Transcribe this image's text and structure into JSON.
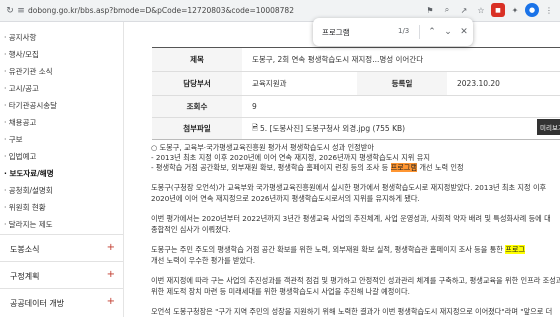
{
  "browser": {
    "url": "dobong.go.kr/bbs.asp?bmode=D&pCode=12720803&code=10008782",
    "find": {
      "query": "프로그램",
      "count": "1/3"
    }
  },
  "sidebar": {
    "sub_items": [
      "공지사항",
      "행사/모집",
      "유관기관 소식",
      "고시/공고",
      "타기관공시송달",
      "채용공고",
      "구보",
      "입법예고",
      "보도자료/해명",
      "공청회/설명회",
      "위원회 현황",
      "달라지는 제도"
    ],
    "active_sub": "보도자료/해명",
    "main_items": [
      "도봉소식",
      "구정계획",
      "공공데이터 개방"
    ]
  },
  "article": {
    "title_label": "제목",
    "title": "도봉구, 2회 연속 평생학습도시 재지정...명성 이어간다",
    "dept_label": "담당부서",
    "dept": "교육지원과",
    "date_label": "등록일",
    "date": "2023.10.20",
    "views_label": "조회수",
    "views": "9",
    "attach_label": "첨부파일",
    "attachment": "5. [도봉사진] 도봉구청사 외경.jpg (755 KB)",
    "preview_btn": "미리보기",
    "body": {
      "lead_1": "○ 도봉구, 교육부·국가평생교육진흥원 평가서 평생학습도시 성과 인정받아",
      "lead_2": "- 2013년 최초 지정 이후 2020년에 이어 연속 재지정, 2026년까지 평생학습도시 지위 유지",
      "lead_3a": "- 평생학습 거점 공간확보, 외부재원 확보, 평생학습 홈페이지 런칭 등의 조사 등 ",
      "lead_3b": "프로그램",
      "lead_3c": " 개선 노력 인정",
      "p1_1": "도봉구(구청장 오언석)가 교육부와 국가평생교육진흥원에서 실시한 평가에서 평생학습도시로 재지정받았다. 2013년 최초 지정 이후",
      "p1_2": "2020년에 이어 연속 재지정으로 2026년까지 평생학습도시로서의 지위를 유지하게 됐다.",
      "p2_1": "이번 평가에서는 2020년부터 2022년까지 3년간 평생교육 사업의 추진체계, 사업 운영성과, 사회적 약자 배려 및 특성화사례 등에 대",
      "p2_2": "종합적인 심사가 이뤄졌다.",
      "p3_1a": "도봉구는 주민 주도의 평생학습 거점 공간 확보를 위한 노력, 외부재원 확보 실적, 평생학습관 홈페이지 조사 등을 통한 ",
      "p3_1b": "프로그",
      "p3_2": "개선 노력이 우수한 평가를 받았다.",
      "p4_1": "이번 재지정에 따라 구는 사업의 추진성과를 객관적 점검 및 평가하고 안정적인 성과관리 체계를 구축하고, 평생교육을 위한 인프라 조성과 다",
      "p4_2": "위한 제도적 장치 마련 등 미래세대를 위한 평생학습도시 사업을 추진해 나갈 예정이다.",
      "p5_1": "오언석 도봉구청장은 \"구가 지역 주민의 성장을 지원하기 위해 노력한 결과가 이번 평생학습도시 재지정으로 이어졌다\"라며 \"앞으로 더"
    }
  }
}
